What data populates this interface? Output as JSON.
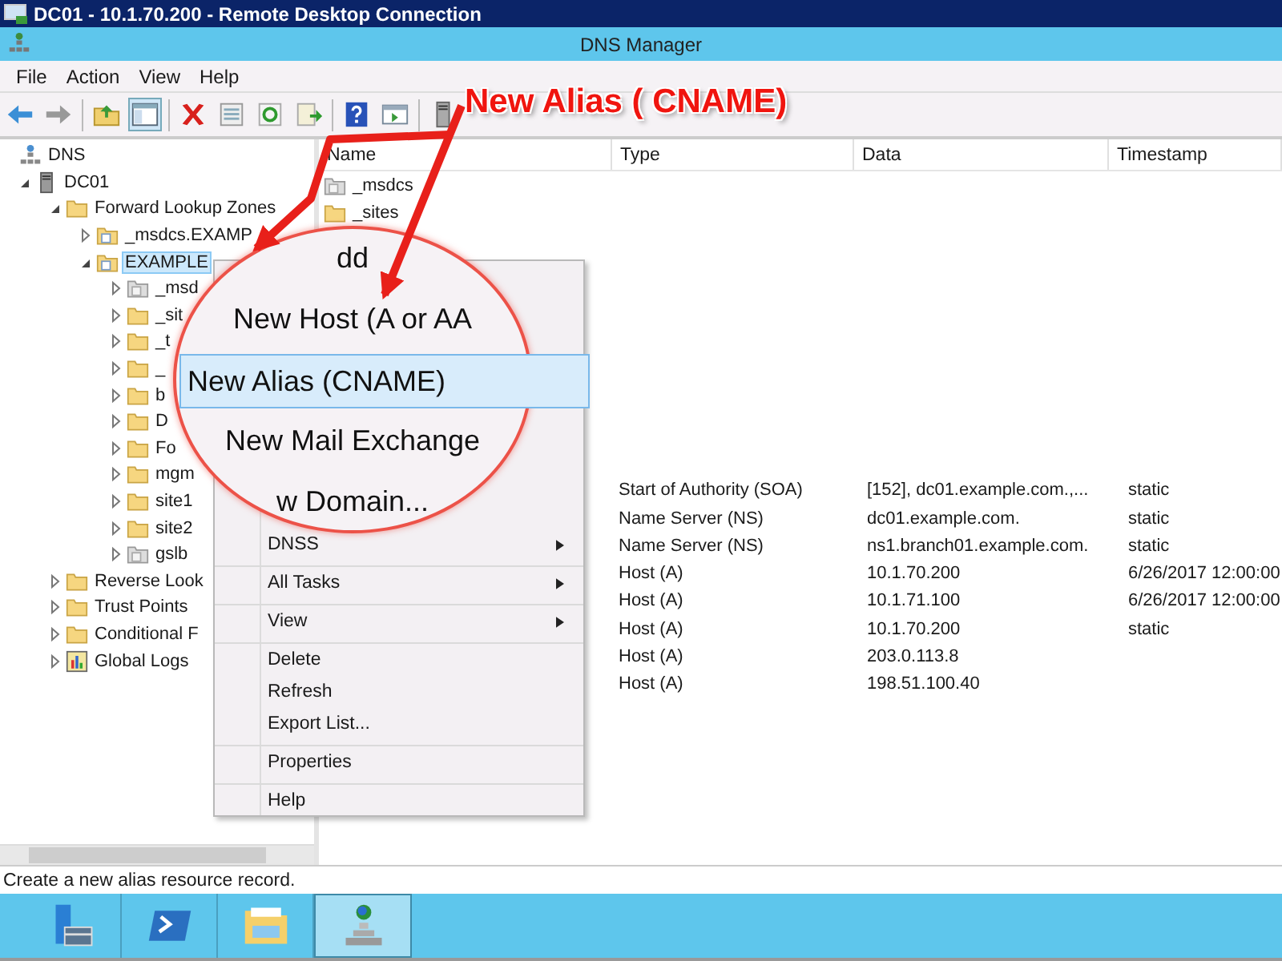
{
  "rdp_window": {
    "title": "DC01 - 10.1.70.200 - Remote Desktop Connection"
  },
  "window": {
    "title": "DNS Manager"
  },
  "menu_bar": [
    "File",
    "Action",
    "View",
    "Help"
  ],
  "tree": [
    {
      "label": "DNS",
      "kind": "dns",
      "selected": false,
      "children": [
        {
          "label": "DC01",
          "kind": "server",
          "expanded": true,
          "selected": false,
          "children": [
            {
              "label": "Forward Lookup Zones",
              "kind": "folder",
              "expanded": true,
              "selected": false,
              "children": [
                {
                  "label": "_msdcs.EXAMP",
                  "kind": "zone",
                  "expanded": false,
                  "selected": false
                },
                {
                  "label": "EXAMPLE",
                  "kind": "zone",
                  "expanded": true,
                  "selected": true,
                  "children": [
                    {
                      "label": "_msd",
                      "kind": "delegation",
                      "expanded": false,
                      "selected": false
                    },
                    {
                      "label": "_sit",
                      "kind": "folder",
                      "expanded": false,
                      "selected": false
                    },
                    {
                      "label": "_t",
                      "kind": "folder",
                      "expanded": false,
                      "selected": false
                    },
                    {
                      "label": "_",
                      "kind": "folder",
                      "expanded": false,
                      "selected": false
                    },
                    {
                      "label": "b",
                      "kind": "folder",
                      "expanded": false,
                      "selected": false
                    },
                    {
                      "label": "D",
                      "kind": "folder",
                      "expanded": false,
                      "selected": false
                    },
                    {
                      "label": "Fo",
                      "kind": "folder",
                      "expanded": false,
                      "selected": false
                    },
                    {
                      "label": "mgm",
                      "kind": "folder",
                      "expanded": false,
                      "selected": false
                    },
                    {
                      "label": "site1",
                      "kind": "folder",
                      "expanded": false,
                      "selected": false
                    },
                    {
                      "label": "site2",
                      "kind": "folder",
                      "expanded": false,
                      "selected": false
                    },
                    {
                      "label": "gslb",
                      "kind": "delegation",
                      "expanded": false,
                      "selected": false
                    }
                  ]
                }
              ]
            },
            {
              "label": "Reverse Look",
              "kind": "folder",
              "expanded": false,
              "selected": false
            },
            {
              "label": "Trust Points",
              "kind": "folder",
              "expanded": false,
              "selected": false
            },
            {
              "label": "Conditional F",
              "kind": "folder",
              "expanded": false,
              "selected": false
            },
            {
              "label": "Global Logs",
              "kind": "log",
              "expanded": false,
              "selected": false
            }
          ]
        }
      ]
    }
  ],
  "list": {
    "columns": [
      "Name",
      "Type",
      "Data",
      "Timestamp"
    ],
    "folders": [
      {
        "name": "_msdcs",
        "kind": "delegation"
      },
      {
        "name": "_sites",
        "kind": "folder"
      }
    ],
    "records": [
      {
        "type": "Start of Authority (SOA)",
        "data": "[152], dc01.example.com.,...",
        "timestamp": "static"
      },
      {
        "type": "Name Server (NS)",
        "data": "dc01.example.com.",
        "timestamp": "static"
      },
      {
        "type": "Name Server (NS)",
        "data": "ns1.branch01.example.com.",
        "timestamp": "static"
      },
      {
        "type": "Host (A)",
        "data": "10.1.70.200",
        "timestamp": "6/26/2017 12:00:00"
      },
      {
        "type": "Host (A)",
        "data": "10.1.71.100",
        "timestamp": "6/26/2017 12:00:00"
      },
      {
        "type": "Host (A)",
        "data": "10.1.70.200",
        "timestamp": "static"
      },
      {
        "type": "Host (A)",
        "data": "203.0.113.8"
      },
      {
        "type": "Host (A)",
        "data": "198.51.100.40"
      }
    ]
  },
  "context_menu": {
    "items": [
      {
        "label": "DNSS",
        "submenu": true,
        "separator_before": false
      },
      {
        "label": "All Tasks",
        "submenu": true,
        "separator_before": true
      },
      {
        "label": "View",
        "submenu": true,
        "separator_before": true
      },
      {
        "label": "Delete",
        "submenu": false,
        "separator_before": true
      },
      {
        "label": "Refresh",
        "submenu": false,
        "separator_before": false
      },
      {
        "label": "Export List...",
        "submenu": false,
        "separator_before": false
      },
      {
        "label": "Properties",
        "submenu": false,
        "separator_before": true
      },
      {
        "label": "Help",
        "submenu": false,
        "separator_before": true
      }
    ]
  },
  "magnifier": {
    "items": [
      {
        "label": "dd",
        "selected": false
      },
      {
        "label": "New Host (A or AA",
        "selected": false
      },
      {
        "label": "New Alias (CNAME)",
        "selected": true
      },
      {
        "label": "New Mail Exchange",
        "selected": false
      },
      {
        "label": "w Domain...",
        "selected": false
      }
    ]
  },
  "annotation": {
    "text": "New Alias ( CNAME)"
  },
  "status_bar": {
    "text": "Create a new alias resource record."
  },
  "taskbar": [
    {
      "kind": "server-manager",
      "selected": false
    },
    {
      "kind": "powershell",
      "selected": false
    },
    {
      "kind": "explorer",
      "selected": false
    },
    {
      "kind": "dns",
      "selected": true
    }
  ]
}
